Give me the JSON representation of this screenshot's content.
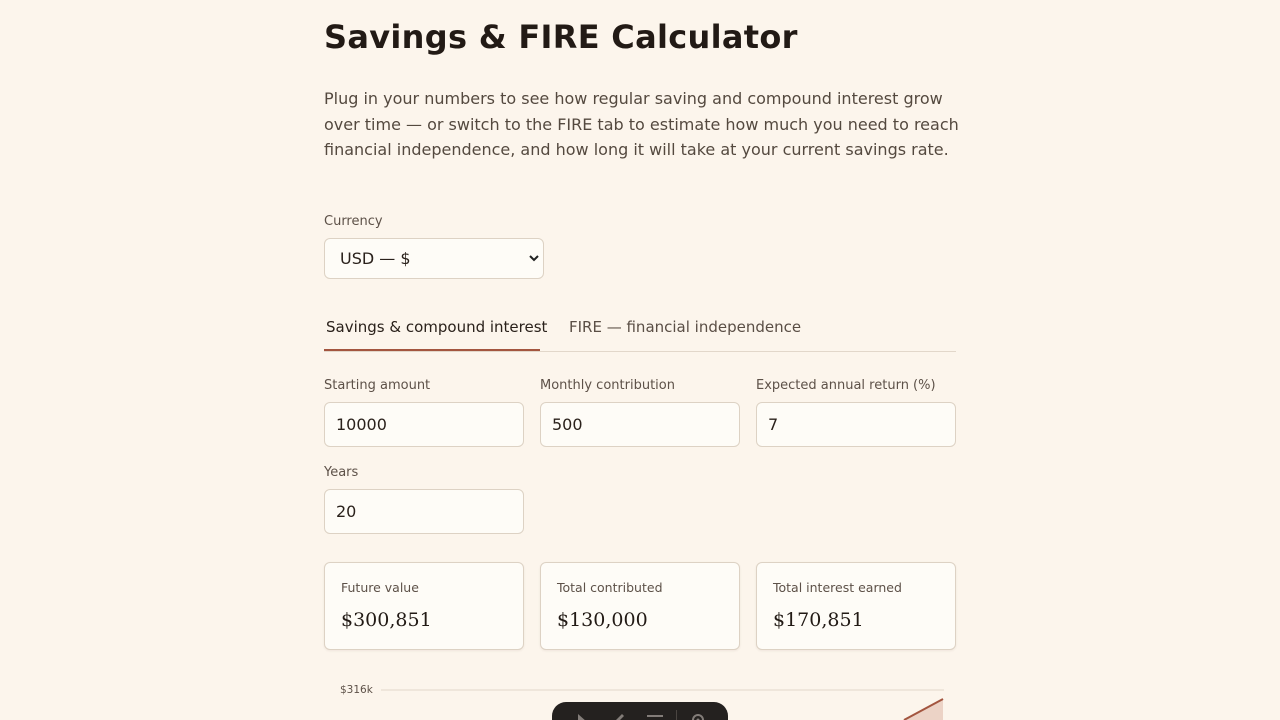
{
  "page": {
    "title": "Savings & FIRE Calculator",
    "intro": "Plug in your numbers to see how regular saving and compound interest grow over time — or switch to the FIRE tab to estimate how much you need to reach financial independence, and how long it will take at your current savings rate."
  },
  "currency": {
    "label": "Currency",
    "selected": "USD — $"
  },
  "tabs": [
    {
      "label": "Savings & compound interest",
      "active": true
    },
    {
      "label": "FIRE — financial independence",
      "active": false
    }
  ],
  "inputs": {
    "starting_amount": {
      "label": "Starting amount",
      "value": "10000"
    },
    "monthly_contribution": {
      "label": "Monthly contribution",
      "value": "500"
    },
    "annual_return": {
      "label": "Expected annual return (%)",
      "value": "7"
    },
    "years": {
      "label": "Years",
      "value": "20"
    }
  },
  "results": [
    {
      "label": "Future value",
      "value": "$300,851"
    },
    {
      "label": "Total contributed",
      "value": "$130,000"
    },
    {
      "label": "Total interest earned",
      "value": "$170,851"
    }
  ],
  "chart": {
    "y_max_label": "$316k"
  },
  "colors": {
    "background": "#fcf5ec",
    "accent": "#a3553f",
    "toolbar": "#24211f"
  },
  "toolbar": {
    "icons": [
      "cursor-icon",
      "brush-icon",
      "menu-icon",
      "gear-icon"
    ]
  }
}
